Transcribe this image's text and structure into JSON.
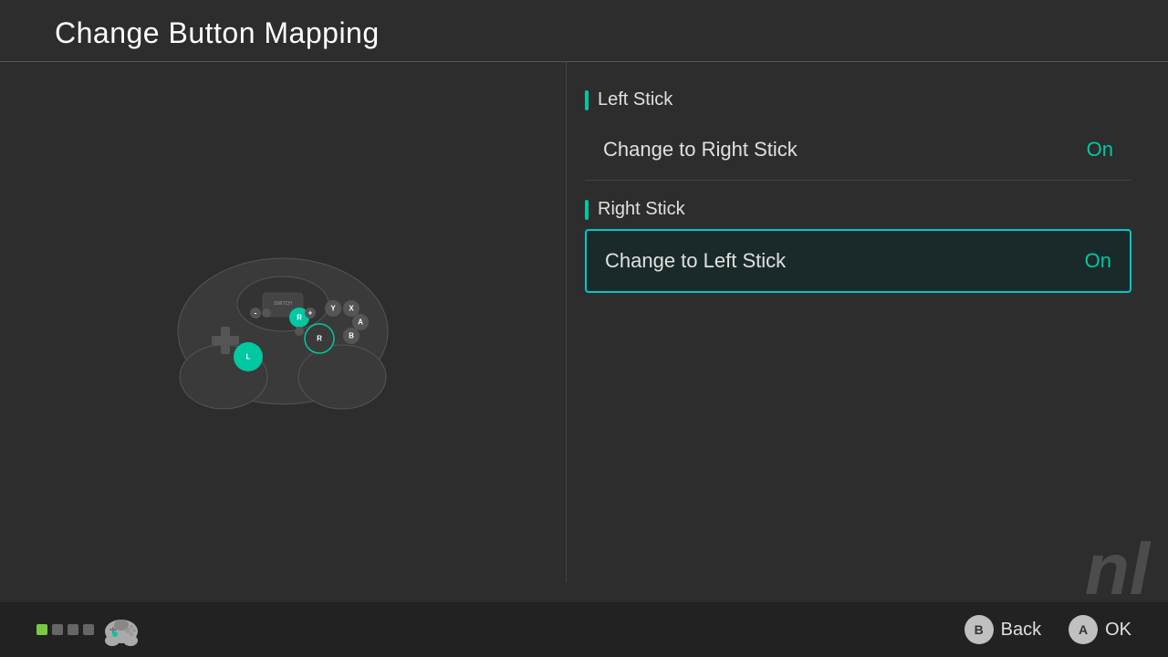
{
  "header": {
    "title": "Change Button Mapping"
  },
  "sections": [
    {
      "id": "left-stick",
      "label": "Left Stick",
      "settings": [
        {
          "id": "change-to-right-stick",
          "label": "Change to Right Stick",
          "value": "On",
          "selected": false
        }
      ]
    },
    {
      "id": "right-stick",
      "label": "Right Stick",
      "settings": [
        {
          "id": "change-to-left-stick",
          "label": "Change to Left Stick",
          "value": "On",
          "selected": true
        }
      ]
    }
  ],
  "bottom": {
    "back_label": "Back",
    "ok_label": "OK",
    "b_button": "B",
    "a_button": "A"
  },
  "dots": [
    {
      "color": "#7ac943",
      "active": true
    },
    {
      "color": "#666",
      "active": false
    },
    {
      "color": "#666",
      "active": false
    },
    {
      "color": "#666",
      "active": false
    }
  ],
  "watermark": "nl"
}
